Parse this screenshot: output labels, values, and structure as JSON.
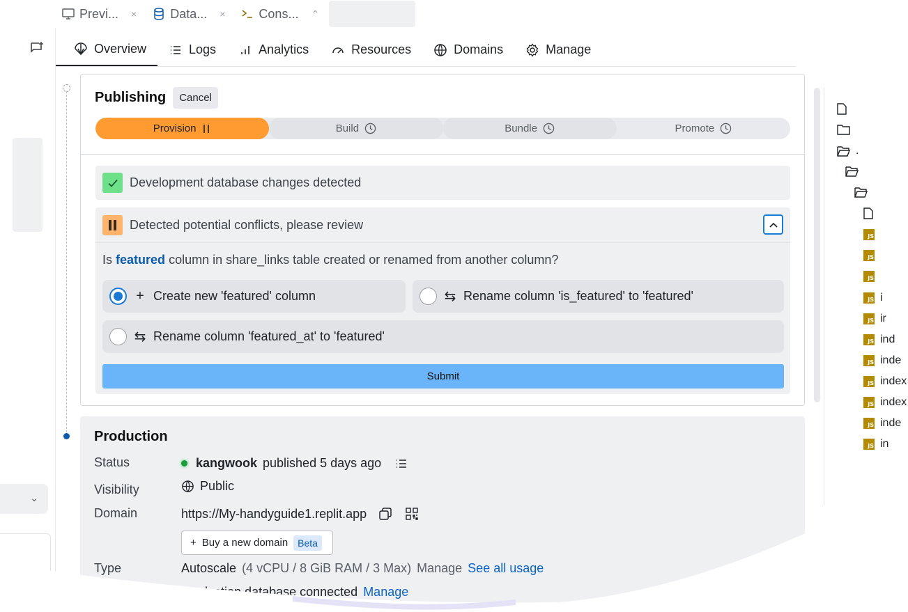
{
  "top_tabs": [
    {
      "label": "Previ...",
      "close": "×"
    },
    {
      "label": "Data...",
      "close": "×"
    },
    {
      "label": "Cons...",
      "close": "⌃"
    }
  ],
  "nav": {
    "overview": "Overview",
    "logs": "Logs",
    "analytics": "Analytics",
    "resources": "Resources",
    "domains": "Domains",
    "manage": "Manage"
  },
  "publishing": {
    "title": "Publishing",
    "cancel_label": "Cancel",
    "steps": [
      {
        "label": "Provision",
        "state": "active"
      },
      {
        "label": "Build",
        "state": "pending"
      },
      {
        "label": "Bundle",
        "state": "pending"
      },
      {
        "label": "Promote",
        "state": "pending"
      }
    ],
    "detected_message": "Development database changes detected",
    "conflict_message": "Detected potential conflicts, please review",
    "question_prefix": "Is",
    "question_highlight": "featured",
    "question_suffix": "column in share_links table created or renamed from another column?",
    "options": [
      {
        "label": "Create new 'featured' column",
        "icon": "plus-icon",
        "selected": true
      },
      {
        "label": "Rename column 'is_featured' to 'featured'",
        "icon": "swap-icon",
        "selected": false
      },
      {
        "label": "Rename column 'featured_at' to 'featured'",
        "icon": "swap-icon",
        "selected": false
      }
    ],
    "submit_label": "Submit"
  },
  "production": {
    "title": "Production",
    "status_label": "Status",
    "status_user": "kangwook",
    "status_text": "published 5 days ago",
    "visibility_label": "Visibility",
    "visibility_value": "Public",
    "domain_label": "Domain",
    "domain_value": "https://My-handyguide1.replit.app",
    "buy_domain_label": "Buy a new domain",
    "beta_label": "Beta",
    "type_label": "Type",
    "type_value": "Autoscale",
    "type_spec": "(4 vCPU / 8 GiB RAM / 3 Max)",
    "type_manage": "Manage",
    "see_all_usage": "See all usage",
    "db_text": "Production database connected",
    "db_manage": "Manage"
  },
  "file_tree": [
    {
      "type": "file",
      "label": ""
    },
    {
      "type": "folder",
      "label": ""
    },
    {
      "type": "folder-open",
      "label": "."
    },
    {
      "type": "folder-open",
      "label": ""
    },
    {
      "type": "folder-open",
      "label": ""
    },
    {
      "type": "file",
      "label": ""
    },
    {
      "type": "js",
      "label": ""
    },
    {
      "type": "js",
      "label": ""
    },
    {
      "type": "js",
      "label": ""
    },
    {
      "type": "js",
      "label": "i"
    },
    {
      "type": "js",
      "label": "ir"
    },
    {
      "type": "js",
      "label": "ind"
    },
    {
      "type": "js",
      "label": "inde"
    },
    {
      "type": "js",
      "label": "index"
    },
    {
      "type": "js",
      "label": "index"
    },
    {
      "type": "js",
      "label": "inde"
    },
    {
      "type": "js",
      "label": "in"
    }
  ],
  "colors": {
    "accent_orange": "#ff9b30",
    "success_green": "#6ee08a",
    "warning_orange": "#ffb36b",
    "primary_blue": "#1a7bd6",
    "submit_blue": "#6ab4fa",
    "link_blue": "#0b63c9"
  }
}
